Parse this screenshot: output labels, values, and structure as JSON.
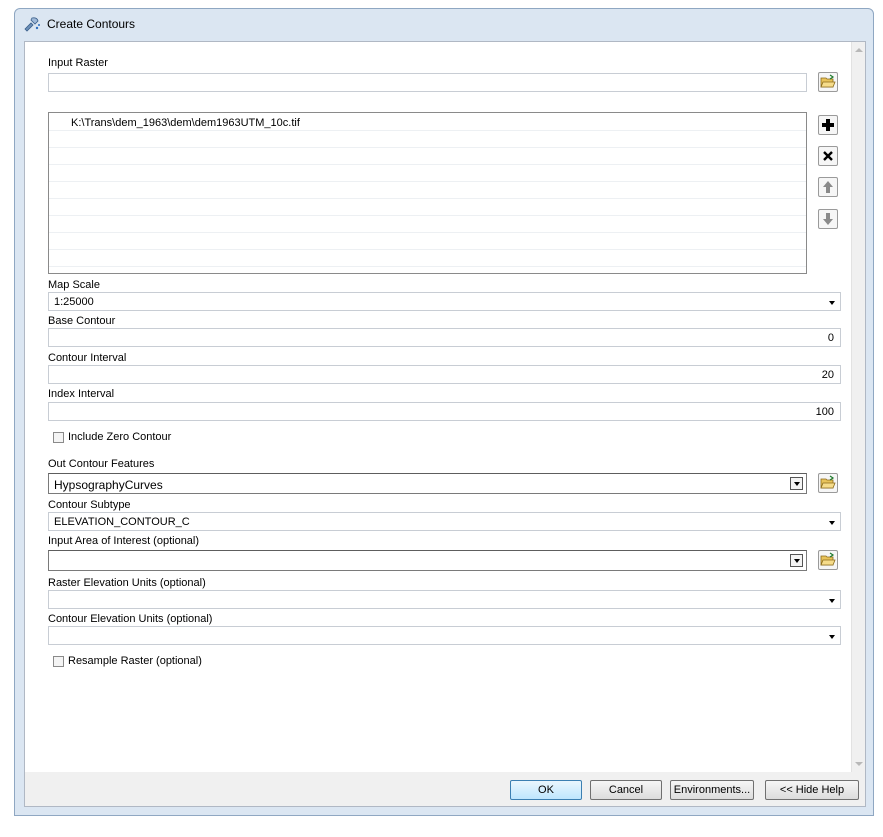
{
  "window": {
    "title": "Create Contours",
    "icon": "toolbox-tool-icon"
  },
  "form": {
    "input_raster": {
      "label": "Input Raster",
      "value": "",
      "browse_icon": "folder-open-icon"
    },
    "raster_list": {
      "items": [
        "K:\\Trans\\dem_1963\\dem\\dem1963UTM_10c.tif"
      ],
      "buttons": {
        "add": "plus-icon",
        "remove": "x-icon",
        "up": "arrow-up-icon",
        "down": "arrow-down-icon"
      }
    },
    "map_scale": {
      "label": "Map Scale",
      "value": "1:25000"
    },
    "base_contour": {
      "label": "Base Contour",
      "value": "0"
    },
    "contour_interval": {
      "label": "Contour Interval",
      "value": "20"
    },
    "index_interval": {
      "label": "Index Interval",
      "value": "100"
    },
    "include_zero": {
      "label": "Include Zero Contour",
      "checked": false
    },
    "out_features": {
      "label": "Out Contour Features",
      "value": "HypsographyCurves"
    },
    "contour_subtype": {
      "label": "Contour Subtype",
      "value": "ELEVATION_CONTOUR_C"
    },
    "area_of_interest": {
      "label": "Input Area of Interest (optional)",
      "value": ""
    },
    "raster_units": {
      "label": "Raster Elevation Units (optional)",
      "value": ""
    },
    "contour_units": {
      "label": "Contour Elevation Units (optional)",
      "value": ""
    },
    "resample": {
      "label": "Resample Raster (optional)",
      "checked": false
    }
  },
  "buttons": {
    "ok": "OK",
    "cancel": "Cancel",
    "environments": "Environments...",
    "hide_help": "<< Hide Help"
  }
}
